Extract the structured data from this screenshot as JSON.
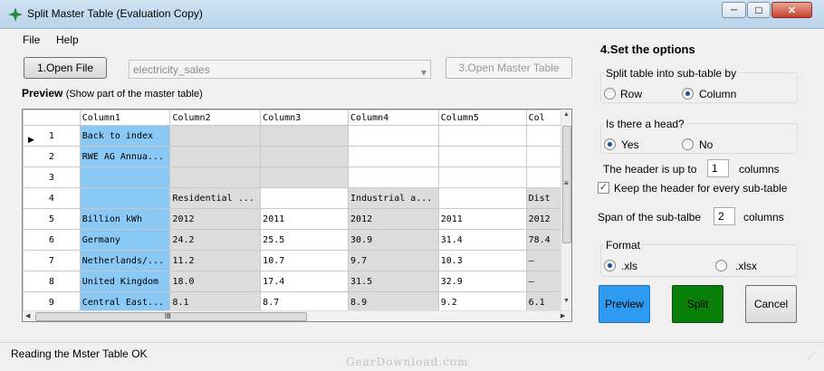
{
  "window": {
    "title": "Split Master Table (Evaluation Copy)",
    "minimize_glyph": "─",
    "maximize_glyph": "□",
    "close_glyph": "✕"
  },
  "menu": {
    "file": "File",
    "help": "Help"
  },
  "toolbar": {
    "open_file": "1.Open File",
    "file_combo_value": "electricity_sales",
    "combo_arrow": "▾",
    "open_master": "3.Open Master Table"
  },
  "preview": {
    "title": "Preview",
    "subtitle": "(Show part of the master table)",
    "columns": [
      "Column1",
      "Column2",
      "Column3",
      "Column4",
      "Column5",
      "Col"
    ],
    "rows": [
      {
        "num": "1",
        "cells": [
          "Back to index",
          "",
          "",
          "",
          "",
          ""
        ]
      },
      {
        "num": "2",
        "cells": [
          "RWE AG Annua...",
          "",
          "",
          "",
          "",
          ""
        ]
      },
      {
        "num": "3",
        "cells": [
          "",
          "",
          "",
          "",
          "",
          ""
        ]
      },
      {
        "num": "4",
        "cells": [
          "",
          "Residential ...",
          "",
          "Industrial a...",
          "",
          "Dist"
        ]
      },
      {
        "num": "5",
        "cells": [
          "Billion kWh",
          "2012",
          "2011",
          "2012",
          "2011",
          "2012"
        ]
      },
      {
        "num": "6",
        "cells": [
          "Germany",
          "24.2",
          "25.5",
          "30.9",
          "31.4",
          "78.4"
        ]
      },
      {
        "num": "7",
        "cells": [
          "Netherlands/...",
          "11.2",
          "10.7",
          "9.7",
          "10.3",
          "–"
        ]
      },
      {
        "num": "8",
        "cells": [
          "United Kingdom",
          "18.0",
          "17.4",
          "31.5",
          "32.9",
          "–"
        ]
      },
      {
        "num": "9",
        "cells": [
          "Central East...",
          "8.1",
          "8.7",
          "8.9",
          "9.2",
          "6.1"
        ]
      }
    ],
    "current_row_marker": "▶",
    "scroll_up": "▲",
    "scroll_down": "▼",
    "scroll_left": "◀",
    "scroll_right": "▶",
    "scroll_grip_v": "≡",
    "scroll_grip_h": "III",
    "highlight_color": "#8ac9f5"
  },
  "options": {
    "title": "4.Set the options",
    "split_by": {
      "label": "Split table into sub-table by",
      "row": "Row",
      "column": "Column",
      "selected": "column"
    },
    "head": {
      "label": "Is there a head?",
      "yes": "Yes",
      "no": "No",
      "selected": "yes"
    },
    "header_up_to": {
      "prefix": "The header is up to",
      "value": "1",
      "suffix": "columns"
    },
    "keep_header": {
      "label": "Keep the header for every sub-table",
      "checked": true,
      "mark": "✓"
    },
    "span": {
      "prefix": "Span of the sub-talbe",
      "value": "2",
      "suffix": "columns"
    },
    "format": {
      "label": "Format",
      "xls": ".xls",
      "xlsx": ".xlsx",
      "selected": "xls"
    }
  },
  "actions": {
    "preview": "Preview",
    "split": "Split",
    "cancel": "Cancel"
  },
  "status": {
    "text": "Reading the Mster Table OK",
    "watermark": "GearDownload.com"
  },
  "colors": {
    "preview_btn": "#2f9bf0",
    "split_btn": "#0a7f0a",
    "accent": "#1e4f8f"
  }
}
